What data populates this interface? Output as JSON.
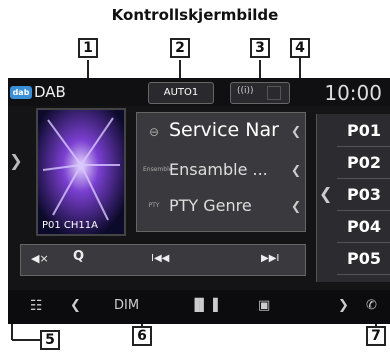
{
  "page": {
    "title": "Kontrollskjermbilde"
  },
  "callouts": [
    "1",
    "2",
    "3",
    "4",
    "5",
    "6",
    "7"
  ],
  "header": {
    "badge": "dab",
    "source": "DAB",
    "mode": "AUTO1",
    "signal": "((i))",
    "clock": "10:00"
  },
  "album_art": {
    "caption": "P01  CH11A"
  },
  "info": {
    "service": "Service Nar",
    "ensemble_tag": "Ensemble",
    "ensemble": "Ensamble ...",
    "pty_tag": "PTY",
    "pty": "PTY Genre"
  },
  "controls": {
    "mute": "◀×",
    "search": "Q",
    "prev": "I◀◀",
    "next": "▶▶I"
  },
  "presets": [
    "P01",
    "P02",
    "P03",
    "P04",
    "P05"
  ],
  "bottombar": {
    "dim": "DIM"
  },
  "colors": {
    "screen_bg": "#141416",
    "panel": "#3a3a3e",
    "badge": "#3a8fd6"
  }
}
